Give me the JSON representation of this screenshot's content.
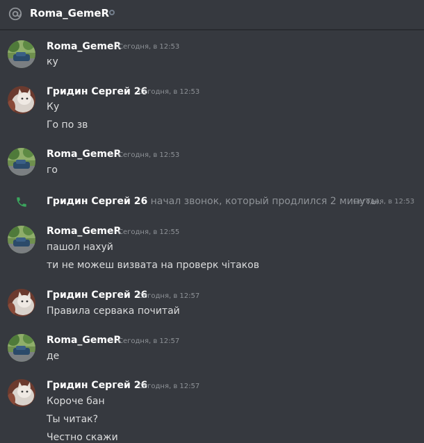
{
  "header": {
    "title": "Roma_GemeR",
    "at_icon": "at-sign-icon",
    "status": "offline"
  },
  "messages": [
    {
      "author": "Roma_GemeR",
      "avatar": "car-photo-avatar",
      "time": "Сегодня, в 12:53",
      "lines": [
        "ку"
      ]
    },
    {
      "author": "Гридин Сергей 26",
      "avatar": "cat-photo-avatar",
      "time": "Сегодня, в 12:53",
      "lines": [
        "Ку",
        "Го по зв"
      ]
    },
    {
      "author": "Roma_GemeR",
      "avatar": "car-photo-avatar",
      "time": "Сегодня, в 12:53",
      "lines": [
        "го"
      ]
    },
    {
      "type": "call",
      "icon": "phone-icon",
      "author": "Гридин Сергей 26",
      "text": "начал звонок, который продлился 2 минуты.",
      "time": "Сегодня, в 12:53"
    },
    {
      "author": "Roma_GemeR",
      "avatar": "car-photo-avatar",
      "time": "Сегодня, в 12:55",
      "lines": [
        "пашол нахуй",
        "ти не можеш визвата на проверк  чітаков"
      ]
    },
    {
      "author": "Гридин Сергей 26",
      "avatar": "cat-photo-avatar",
      "time": "Сегодня, в 12:57",
      "lines": [
        "Правила сервака почитай"
      ]
    },
    {
      "author": "Roma_GemeR",
      "avatar": "car-photo-avatar",
      "time": "Сегодня, в 12:57",
      "lines": [
        "де"
      ]
    },
    {
      "author": "Гридин Сергей 26",
      "avatar": "cat-photo-avatar",
      "time": "Сегодня, в 12:57",
      "lines": [
        "Короче бан",
        "Ты читак?",
        "Честно скажи"
      ]
    }
  ],
  "colors": {
    "background": "#36393f",
    "username": "#ffffff",
    "text": "#dcddde",
    "muted": "#8e9297",
    "call_green": "#3ba55d"
  }
}
